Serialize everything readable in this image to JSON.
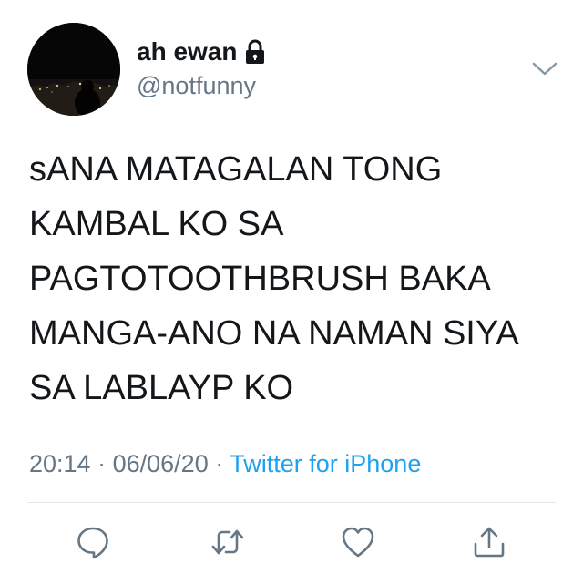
{
  "user": {
    "display_name": "ah ewan",
    "handle": "@notfunny",
    "protected_icon": "lock-icon"
  },
  "tweet": {
    "lines": [
      "sANA MATAGALAN TONG",
      "KAMBAL KO SA",
      "PAGTOTOOTHBRUSH BAKA",
      "MANGA-ANO NA NAMAN SIYA",
      "SA LABLAYP KO"
    ]
  },
  "meta": {
    "time": "20:14",
    "separator": "·",
    "date": "06/06/20",
    "source": "Twitter for iPhone"
  },
  "icons": {
    "menu": "chevron-down-icon",
    "reply": "reply-icon",
    "retweet": "retweet-icon",
    "like": "heart-icon",
    "share": "share-icon"
  },
  "colors": {
    "text": "#14171a",
    "secondary": "#657786",
    "link": "#1da1f2",
    "divider": "#e1e8ed"
  }
}
